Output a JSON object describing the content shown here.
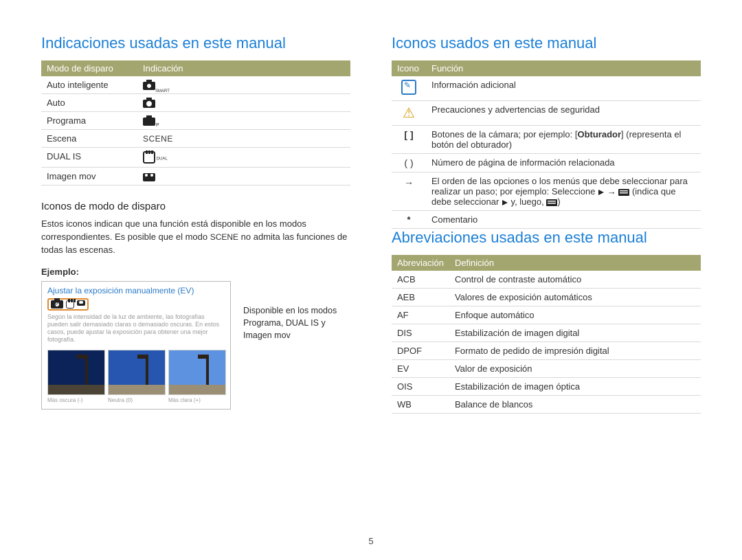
{
  "page_number": "5",
  "left": {
    "heading": "Indicaciones usadas en este manual",
    "table1": {
      "h1": "Modo de disparo",
      "h2": "Indicación",
      "rows": [
        {
          "mode": "Auto inteligente",
          "icon": "smart-auto-icon"
        },
        {
          "mode": "Auto",
          "icon": "auto-icon"
        },
        {
          "mode": "Programa",
          "icon": "program-icon"
        },
        {
          "mode": "Escena",
          "icon": "scene-icon",
          "text": "SCENE"
        },
        {
          "mode": "DUAL IS",
          "icon": "dual-is-icon"
        },
        {
          "mode": "Imagen mov",
          "icon": "movie-icon"
        }
      ]
    },
    "sub": "Iconos de modo de disparo",
    "para_part1": "Estos iconos indican que una función está disponible en los modos correspondientes. Es posible que el modo ",
    "para_scene": "SCENE",
    "para_part2": " no admita las funciones de todas las escenas.",
    "example_label": "Ejemplo:",
    "example_title": "Ajustar la exposición manualmente (EV)",
    "example_tiny": "Según la intensidad de la luz de ambiente, las fotografías pueden salir demasiado claras o demasiado oscuras. En estos casos, puede ajustar la exposición para obtener una mejor fotografía.",
    "thumb_caps": [
      "Más oscura (-)",
      "Neutra (0)",
      "Más clara (+)"
    ],
    "example_aside": "Disponible en los modos Programa, DUAL IS y Imagen mov"
  },
  "right": {
    "heading1": "Iconos usados en este manual",
    "table_icons": {
      "h1": "Icono",
      "h2": "Función",
      "rows": [
        {
          "iconName": "note-icon",
          "func": "Información adicional"
        },
        {
          "iconName": "warning-icon",
          "func": "Precauciones y advertencias de seguridad"
        },
        {
          "iconName": "brackets-icon",
          "sym": "[  ]",
          "func_pre": "Botones de la cámara; por ejemplo: [",
          "bold": "Obturador",
          "func_post": "] (representa el botón del obturador)"
        },
        {
          "iconName": "parens-icon",
          "sym": "(  )",
          "func": "Número de página de información relacionada"
        },
        {
          "iconName": "arrow-icon",
          "sym": "→",
          "func_pre": "El orden de las opciones o los menús que debe seleccionar para realizar un paso; por ejemplo: Seleccione ",
          "func_post": " (indica que debe seleccionar ",
          "func_tail": " y, luego, ",
          "func_end": ")"
        },
        {
          "iconName": "asterisk-icon",
          "sym": "*",
          "func": "Comentario"
        }
      ]
    },
    "heading2": "Abreviaciones usadas en este manual",
    "table_abbr": {
      "h1": "Abreviación",
      "h2": "Definición",
      "rows": [
        {
          "ab": "ACB",
          "def": "Control de contraste automático"
        },
        {
          "ab": "AEB",
          "def": "Valores de exposición automáticos"
        },
        {
          "ab": "AF",
          "def": "Enfoque automático"
        },
        {
          "ab": "DIS",
          "def": "Estabilización de imagen digital"
        },
        {
          "ab": "DPOF",
          "def": "Formato de pedido de impresión digital"
        },
        {
          "ab": "EV",
          "def": "Valor de exposición"
        },
        {
          "ab": "OIS",
          "def": "Estabilización de imagen óptica"
        },
        {
          "ab": "WB",
          "def": "Balance de blancos"
        }
      ]
    }
  }
}
